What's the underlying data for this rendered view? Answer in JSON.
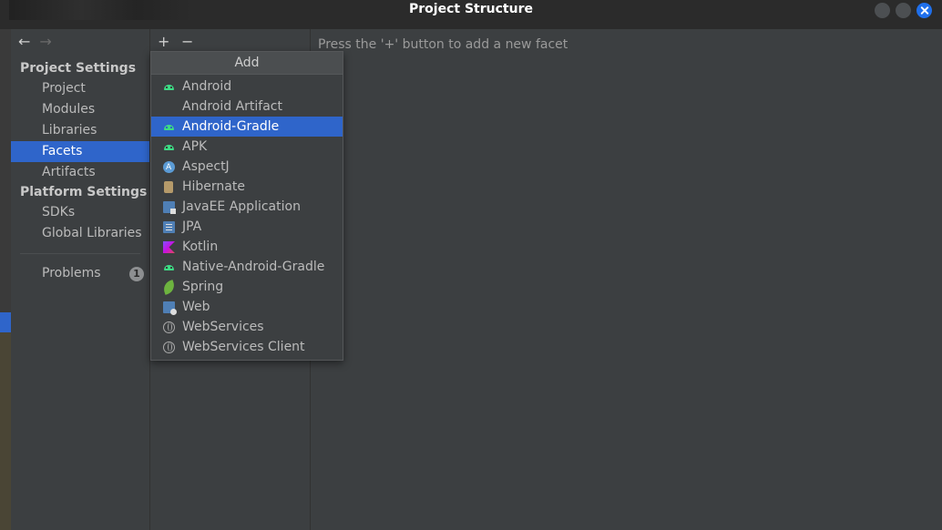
{
  "window": {
    "title": "Project Structure"
  },
  "nav": {
    "back_icon": "arrow-left-icon",
    "forward_icon": "arrow-right-icon",
    "project_settings_header": "Project Settings",
    "project_settings": [
      "Project",
      "Modules",
      "Libraries",
      "Facets",
      "Artifacts"
    ],
    "platform_settings_header": "Platform Settings",
    "platform_settings": [
      "SDKs",
      "Global Libraries"
    ],
    "problems_label": "Problems",
    "problems_count": "1",
    "selected": "Facets"
  },
  "toolbar": {
    "add_symbol": "+",
    "remove_symbol": "−"
  },
  "content": {
    "hint": "Press the '+' button to add a new facet"
  },
  "popup": {
    "title": "Add",
    "selected": "Android-Gradle",
    "items": [
      {
        "label": "Android",
        "icon": "android-icon"
      },
      {
        "label": "Android Artifact",
        "icon": ""
      },
      {
        "label": "Android-Gradle",
        "icon": "android-icon"
      },
      {
        "label": "APK",
        "icon": "android-icon"
      },
      {
        "label": "AspectJ",
        "icon": "aspectj-icon"
      },
      {
        "label": "Hibernate",
        "icon": "hibernate-icon"
      },
      {
        "label": "JavaEE Application",
        "icon": "javaee-icon"
      },
      {
        "label": "JPA",
        "icon": "jpa-icon"
      },
      {
        "label": "Kotlin",
        "icon": "kotlin-icon"
      },
      {
        "label": "Native-Android-Gradle",
        "icon": "android-icon"
      },
      {
        "label": "Spring",
        "icon": "spring-icon"
      },
      {
        "label": "Web",
        "icon": "web-icon"
      },
      {
        "label": "WebServices",
        "icon": "globe-icon"
      },
      {
        "label": "WebServices Client",
        "icon": "globe-icon"
      }
    ]
  },
  "colors": {
    "selection": "#2f65ca",
    "background": "#3c3f41",
    "titlebar": "#2b2b2b",
    "android_green": "#3ddc84"
  }
}
